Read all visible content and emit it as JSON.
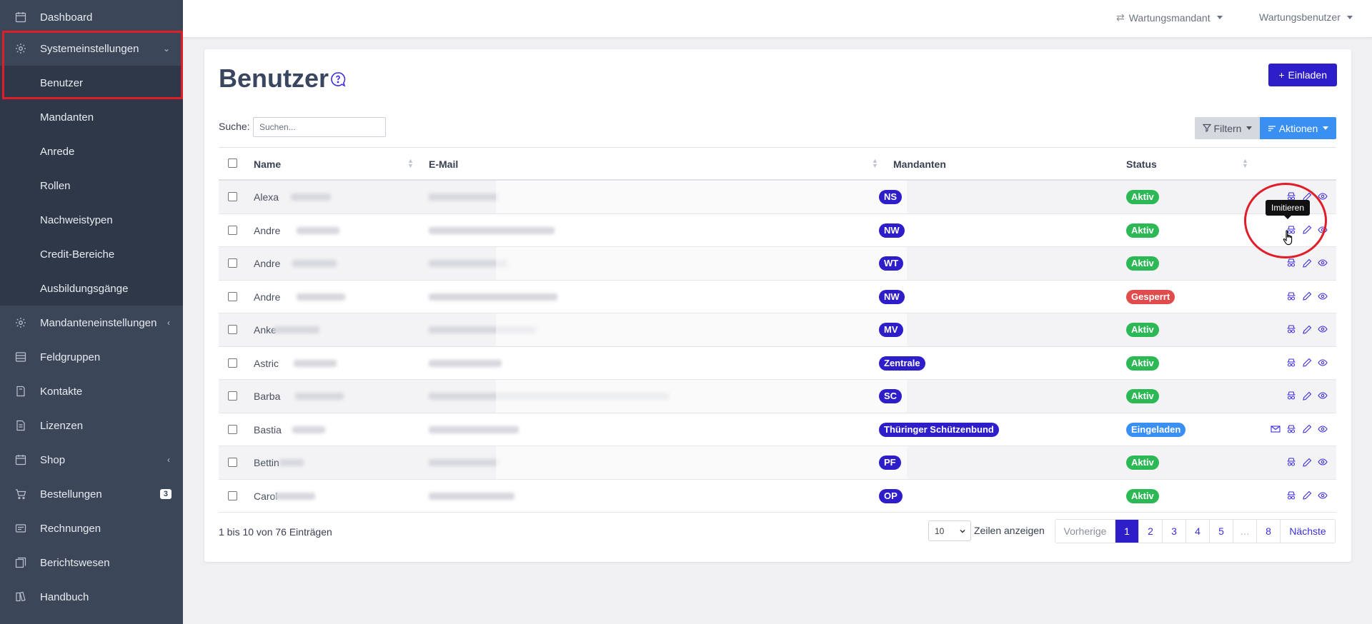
{
  "sidebar": {
    "items": [
      {
        "label": "Dashboard",
        "icon": "calendar-icon"
      },
      {
        "label": "Systemeinstellungen",
        "icon": "gear-icon",
        "chevron": "⌄"
      },
      {
        "label": "Benutzer"
      },
      {
        "label": "Mandanten"
      },
      {
        "label": "Anrede"
      },
      {
        "label": "Rollen"
      },
      {
        "label": "Nachweistypen"
      },
      {
        "label": "Credit-Bereiche"
      },
      {
        "label": "Ausbildungsgänge"
      },
      {
        "label": "Mandanteneinstellungen",
        "icon": "gear-icon",
        "chevron": "‹"
      },
      {
        "label": "Feldgruppen",
        "icon": "list-icon"
      },
      {
        "label": "Kontakte",
        "icon": "book-icon"
      },
      {
        "label": "Lizenzen",
        "icon": "document-icon"
      },
      {
        "label": "Shop",
        "icon": "calendar-icon",
        "chevron": "‹"
      },
      {
        "label": "Bestellungen",
        "icon": "cart-icon",
        "badge": "3"
      },
      {
        "label": "Rechnungen",
        "icon": "invoice-icon"
      },
      {
        "label": "Berichtswesen",
        "icon": "reports-icon"
      },
      {
        "label": "Handbuch",
        "icon": "handbook-icon"
      }
    ]
  },
  "topbar": {
    "tenant": "Wartungsmandant",
    "user": "Wartungsbenutzer"
  },
  "page": {
    "title": "Benutzer",
    "invite_label": "Einladen",
    "search_label": "Suche:",
    "search_placeholder": "Suchen...",
    "filter_label": "Filtern",
    "actions_label": "Aktionen"
  },
  "table": {
    "columns": [
      "Name",
      "E-Mail",
      "Mandanten",
      "Status"
    ],
    "rows": [
      {
        "name": "Alexa",
        "tenant": "NS",
        "status": "Aktiv",
        "status_type": "green"
      },
      {
        "name": "Andre",
        "tenant": "NW",
        "status": "Aktiv",
        "status_type": "green"
      },
      {
        "name": "Andre",
        "tenant": "WT",
        "status": "Aktiv",
        "status_type": "green"
      },
      {
        "name": "Andre",
        "tenant": "NW",
        "status": "Gesperrt",
        "status_type": "red"
      },
      {
        "name": "Anke",
        "tenant": "MV",
        "status": "Aktiv",
        "status_type": "green"
      },
      {
        "name": "Astric",
        "tenant": "Zentrale",
        "status": "Aktiv",
        "status_type": "green"
      },
      {
        "name": "Barba",
        "tenant": "SC",
        "status": "Aktiv",
        "status_type": "green"
      },
      {
        "name": "Bastia",
        "tenant": "Thüringer Schützenbund",
        "status": "Eingeladen",
        "status_type": "blue"
      },
      {
        "name": "Bettin",
        "tenant": "PF",
        "status": "Aktiv",
        "status_type": "green"
      },
      {
        "name": "Carol",
        "tenant": "OP",
        "status": "Aktiv",
        "status_type": "green"
      }
    ],
    "tooltip": "Imitieren"
  },
  "footer": {
    "info": "1 bis 10 von 76 Einträgen",
    "page_length": "10",
    "page_length_label": "Zeilen anzeigen",
    "pager": {
      "prev": "Vorherige",
      "pages": [
        "1",
        "2",
        "3",
        "4",
        "5",
        "…",
        "8"
      ],
      "next": "Nächste",
      "active": "1"
    }
  },
  "colors": {
    "sidebar_bg": "#3b4659",
    "primary": "#2e1ec9",
    "info": "#3a8ff2",
    "success": "#2db856",
    "danger": "#e04b4b",
    "highlight": "#e01e28"
  }
}
